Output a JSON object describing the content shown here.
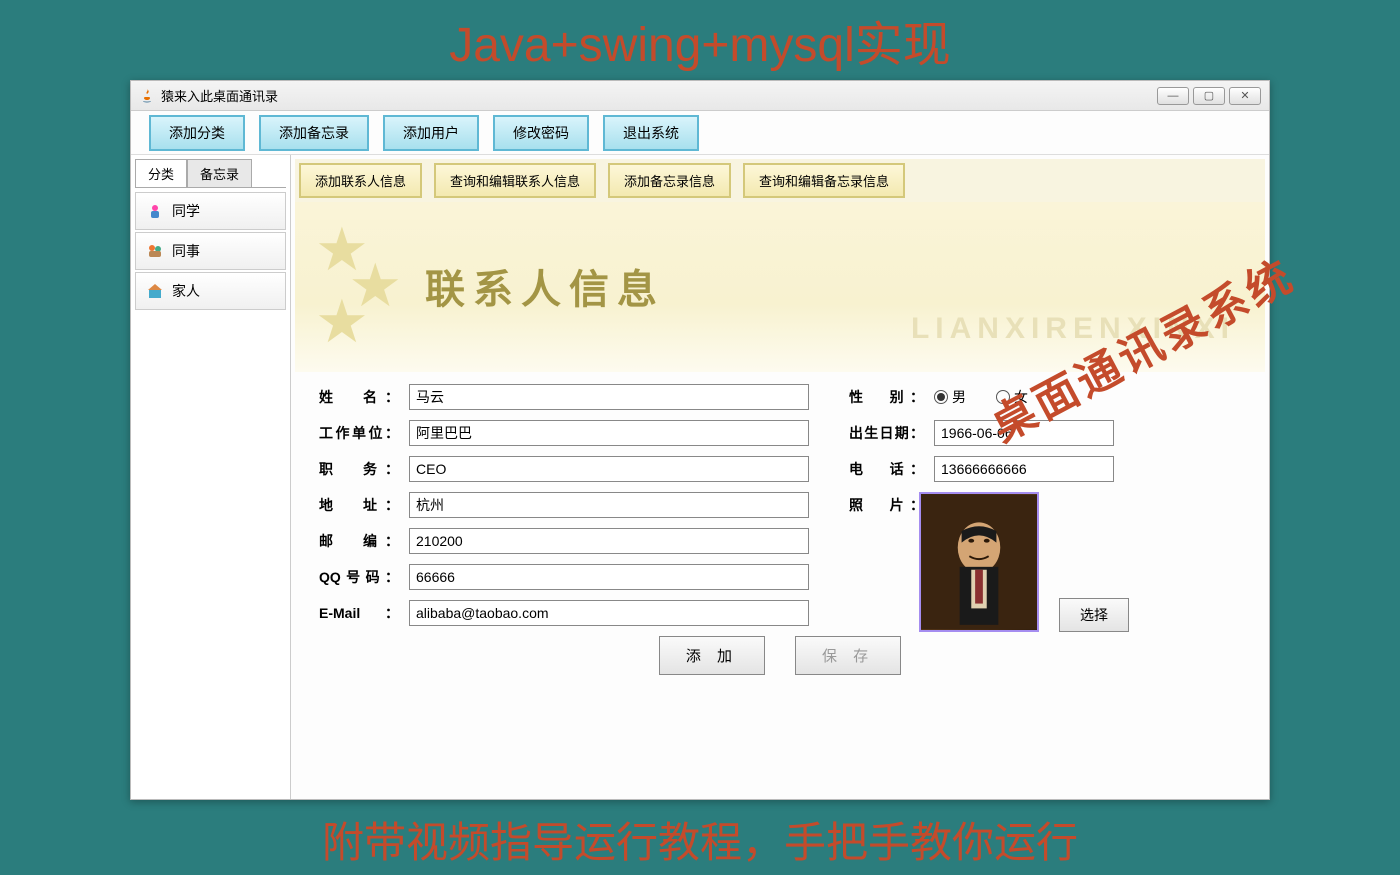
{
  "header": "Java+swing+mysql实现",
  "footer": "附带视频指导运行教程，手把手教你运行",
  "overlay": "桌面通讯录系统",
  "window": {
    "title": "猿来入此桌面通讯录",
    "controls": {
      "min": "—",
      "max": "▢",
      "close": "✕"
    }
  },
  "toolbar": {
    "btn1": "添加分类",
    "btn2": "添加备忘录",
    "btn3": "添加用户",
    "btn4": "修改密码",
    "btn5": "退出系统"
  },
  "sidebar": {
    "tab1": "分类",
    "tab2": "备忘录",
    "item1": "同学",
    "item2": "同事",
    "item3": "家人"
  },
  "subToolbar": {
    "b1": "添加联系人信息",
    "b2": "查询和编辑联系人信息",
    "b3": "添加备忘录信息",
    "b4": "查询和编辑备忘录信息"
  },
  "banner": {
    "title": "联系人信息",
    "subtitle": "LIANXIRENXINXI"
  },
  "form": {
    "name_label": "姓　名：",
    "name_value": "马云",
    "gender_label": "性　别：",
    "gender_male": "男",
    "gender_female": "女",
    "gender_selected": "male",
    "company_label": "工作单位：",
    "company_value": "阿里巴巴",
    "birth_label": "出生日期：",
    "birth_value": "1966-06-06",
    "position_label": "职　务：",
    "position_value": "CEO",
    "phone_label": "电　话：",
    "phone_value": "13666666666",
    "address_label": "地　址：",
    "address_value": "杭州",
    "photo_label": "照　片：",
    "zip_label": "邮　编：",
    "zip_value": "210200",
    "qq_label": "QQ号码：",
    "qq_value": "66666",
    "email_label": "E-Mail：",
    "email_value": "alibaba@taobao.com",
    "select_photo": "选择",
    "add_btn": "添 加",
    "save_btn": "保 存"
  }
}
